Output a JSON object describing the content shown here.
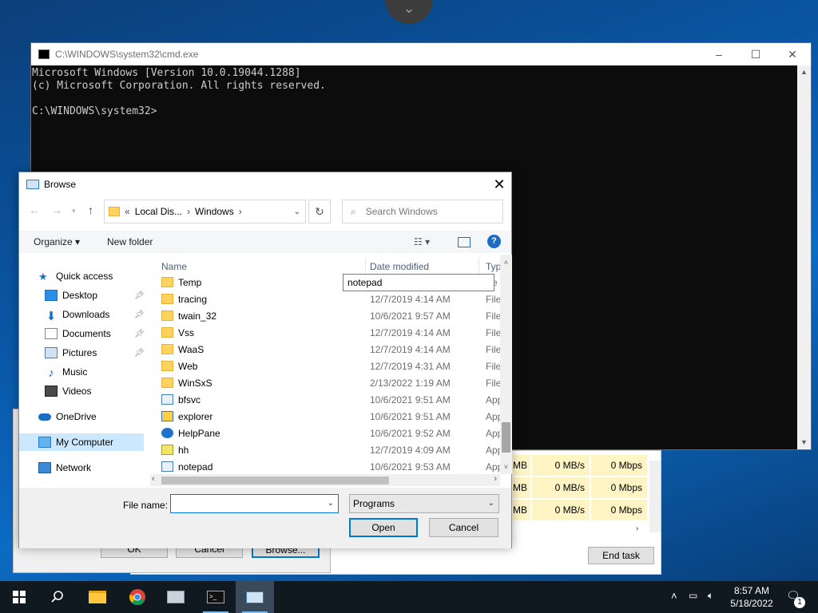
{
  "cmd": {
    "title": "C:\\WINDOWS\\system32\\cmd.exe",
    "line1": "Microsoft Windows [Version 10.0.19044.1288]",
    "line2": "(c) Microsoft Corporation. All rights reserved.",
    "prompt": "C:\\WINDOWS\\system32>",
    "minimize": "–",
    "maximize": "☐",
    "close": "✕"
  },
  "taskmanager": {
    "cells": [
      "MB",
      "0 MB/s",
      "0 Mbps",
      "MB",
      "0 MB/s",
      "0 Mbps",
      "MB",
      "0 MB/s",
      "0 Mbps"
    ],
    "end_task": "End task"
  },
  "run": {
    "ok": "OK",
    "cancel": "Cancel",
    "browse": "Browse..."
  },
  "browse": {
    "title": "Browse",
    "breadcrumb": [
      "«",
      "Local Dis...",
      "›",
      "Windows",
      "›"
    ],
    "search_placeholder": "Search Windows",
    "organize": "Organize ▾",
    "new_folder": "New folder",
    "columns": {
      "name": "Name",
      "date": "Date modified",
      "type": "Typ"
    },
    "nav": [
      {
        "label": "Quick access",
        "icon": "star-icon"
      },
      {
        "label": "Desktop",
        "icon": "desktop-icon",
        "pinned": true
      },
      {
        "label": "Downloads",
        "icon": "download-icon",
        "pinned": true
      },
      {
        "label": "Documents",
        "icon": "documents-icon",
        "pinned": true
      },
      {
        "label": "Pictures",
        "icon": "pictures-icon",
        "pinned": true
      },
      {
        "label": "Music",
        "icon": "music-icon"
      },
      {
        "label": "Videos",
        "icon": "videos-icon"
      },
      {
        "label": "OneDrive",
        "icon": "cloud-icon"
      },
      {
        "label": "My Computer",
        "icon": "computer-icon",
        "selected": true
      },
      {
        "label": "Network",
        "icon": "network-icon"
      }
    ],
    "rename_value": "notepad",
    "files": [
      {
        "name": "Temp",
        "date": "",
        "type": "e",
        "icon": "folder"
      },
      {
        "name": "tracing",
        "date": "12/7/2019 4:14 AM",
        "type": "File",
        "icon": "folder"
      },
      {
        "name": "twain_32",
        "date": "10/6/2021 9:57 AM",
        "type": "File",
        "icon": "folder"
      },
      {
        "name": "Vss",
        "date": "12/7/2019 4:14 AM",
        "type": "File",
        "icon": "folder"
      },
      {
        "name": "WaaS",
        "date": "12/7/2019 4:14 AM",
        "type": "File",
        "icon": "folder"
      },
      {
        "name": "Web",
        "date": "12/7/2019 4:31 AM",
        "type": "File",
        "icon": "folder"
      },
      {
        "name": "WinSxS",
        "date": "2/13/2022 1:19 AM",
        "type": "File",
        "icon": "folder"
      },
      {
        "name": "bfsvc",
        "date": "10/6/2021 9:51 AM",
        "type": "App",
        "icon": "app"
      },
      {
        "name": "explorer",
        "date": "10/6/2021 9:51 AM",
        "type": "App",
        "icon": "exp"
      },
      {
        "name": "HelpPane",
        "date": "10/6/2021 9:52 AM",
        "type": "App",
        "icon": "help"
      },
      {
        "name": "hh",
        "date": "12/7/2019 4:09 AM",
        "type": "App",
        "icon": "hh"
      },
      {
        "name": "notepad",
        "date": "10/6/2021 9:53 AM",
        "type": "App",
        "icon": "app"
      }
    ],
    "file_name_label": "File name:",
    "file_name_value": "",
    "file_type": "Programs",
    "open": "Open",
    "cancel": "Cancel"
  },
  "taskbar": {
    "time": "8:57 AM",
    "date": "5/18/2022",
    "notification_count": "1"
  }
}
